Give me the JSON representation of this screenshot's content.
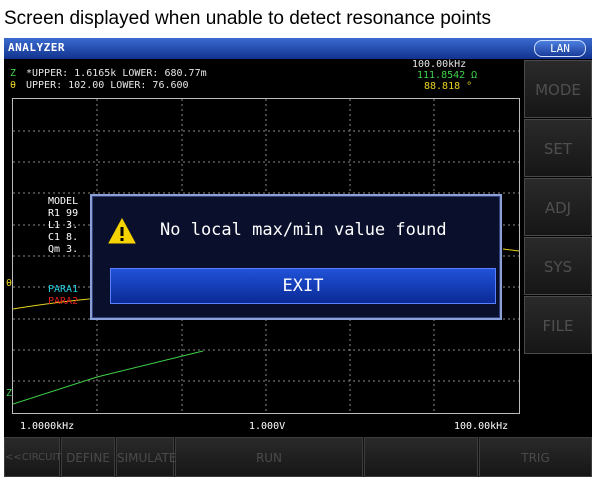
{
  "caption": "Screen displayed when unable to detect resonance points",
  "titlebar": {
    "title": "ANALYZER",
    "lan": "LAN"
  },
  "readout": {
    "z_symbol": "Z",
    "theta_symbol": "θ",
    "z_limits": "*UPPER: 1.6165k LOWER: 680.77m",
    "theta_limits": "UPPER: 102.00  LOWER: 76.600",
    "frequency": "100.00kHz",
    "z_value": "111.8542 Ω",
    "theta_value": "88.818  °"
  },
  "model_panel": {
    "title": "MODEL",
    "lines": [
      "R1 99",
      "L1 3.",
      "C1 8.",
      "Qm 3."
    ],
    "para1": "PARA1",
    "para2": "PARA2"
  },
  "axis": {
    "left_theta": "θ",
    "left_z": "Z",
    "x_start": "1.0000kHz",
    "level": "1.000V",
    "x_end": "100.00kHz"
  },
  "side_menu": [
    "MODE",
    "SET",
    "ADJ",
    "SYS",
    "FILE"
  ],
  "bottom_menu": [
    "<<CIRCUIT",
    "DEFINE",
    "SIMULATE",
    "RUN",
    "",
    "TRIG"
  ],
  "dialog": {
    "message": "No local max/min value found",
    "exit_label": "EXIT"
  },
  "colors": {
    "z": "#3fd24a",
    "theta": "#e8d21e",
    "para1": "#23d0e0",
    "para2": "#e02020",
    "grid": "#8a8a8a",
    "accent": "#1f4fd0"
  }
}
